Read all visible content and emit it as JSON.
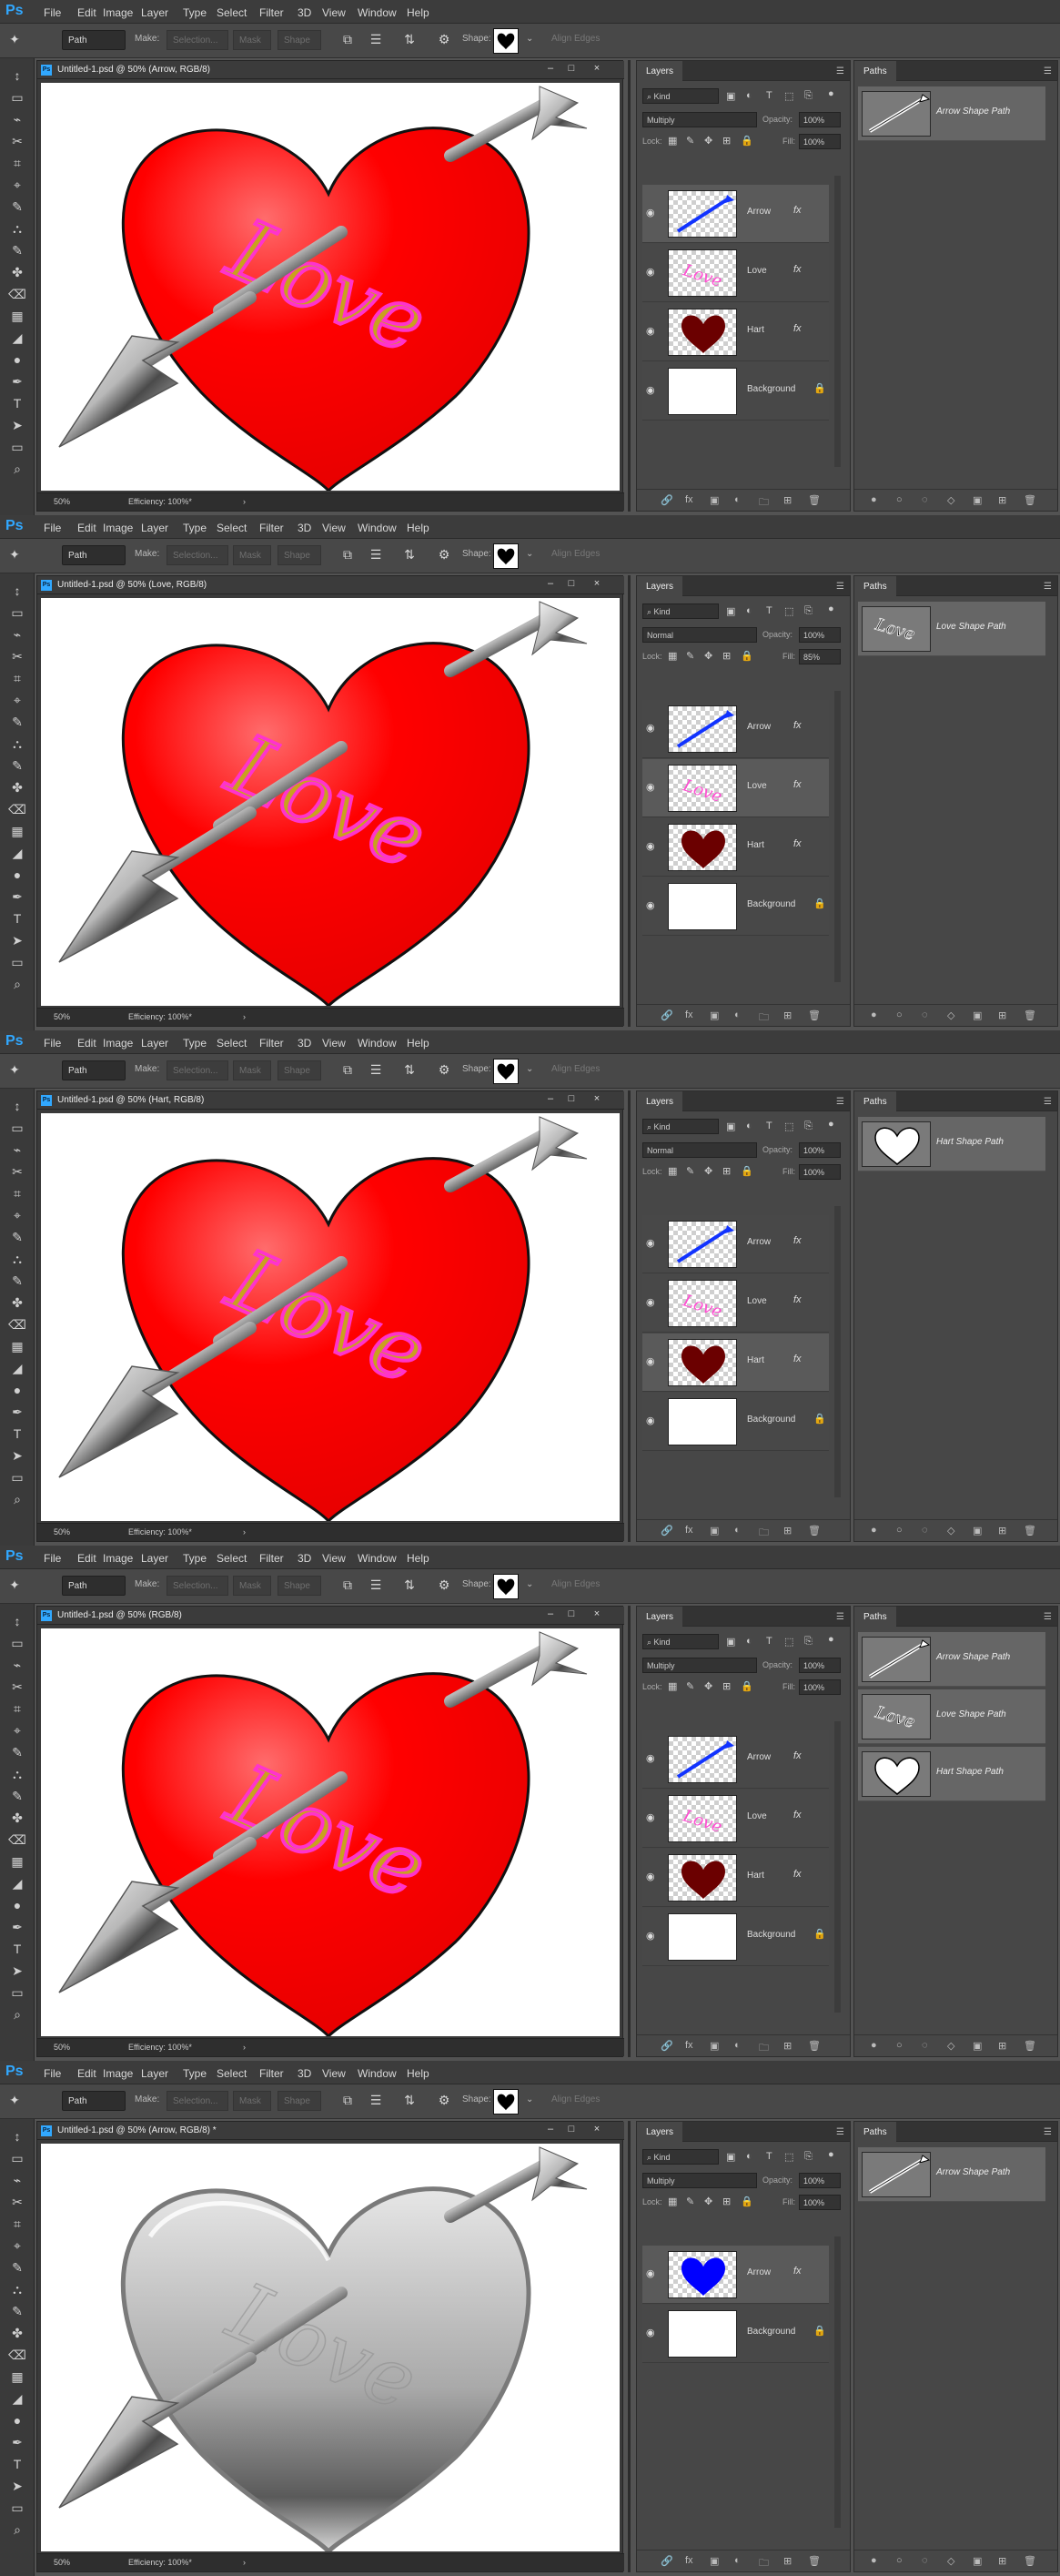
{
  "menu": [
    "File",
    "Edit",
    "Image",
    "Layer",
    "Type",
    "Select",
    "Filter",
    "3D",
    "View",
    "Window",
    "Help"
  ],
  "options": {
    "mode": "Path",
    "make_label": "Make:",
    "selection": "Selection...",
    "mask": "Mask",
    "shape": "Shape",
    "shape_label": "Shape:",
    "align_edges": "Align Edges"
  },
  "status": {
    "zoom": "50%",
    "efficiency": "Efficiency: 100%*"
  },
  "panel": {
    "layers_tab": "Layers",
    "paths_tab": "Paths",
    "kind": "Kind",
    "opacity_label": "Opacity:",
    "lock_label": "Lock:",
    "fill_label": "Fill:"
  },
  "shots": [
    {
      "doc_title": "Untitled-1.psd @ 50% (Arrow, RGB/8)",
      "blend": "Multiply",
      "opacity": "100%",
      "fill": "100%",
      "layers": [
        {
          "name": "Arrow",
          "fx": true,
          "selected": true
        },
        {
          "name": "Love",
          "fx": true
        },
        {
          "name": "Hart",
          "fx": true
        },
        {
          "name": "Background",
          "lock": true
        }
      ],
      "paths": [
        {
          "name": "Arrow Shape Path"
        }
      ]
    },
    {
      "doc_title": "Untitled-1.psd @ 50% (Love, RGB/8)",
      "blend": "Normal",
      "opacity": "100%",
      "fill": "85%",
      "layers": [
        {
          "name": "Arrow",
          "fx": true
        },
        {
          "name": "Love",
          "fx": true,
          "selected": true
        },
        {
          "name": "Hart",
          "fx": true
        },
        {
          "name": "Background",
          "lock": true
        }
      ],
      "paths": [
        {
          "name": "Love Shape Path"
        }
      ]
    },
    {
      "doc_title": "Untitled-1.psd @ 50% (Hart, RGB/8)",
      "blend": "Normal",
      "opacity": "100%",
      "fill": "100%",
      "layers": [
        {
          "name": "Arrow",
          "fx": true
        },
        {
          "name": "Love",
          "fx": true
        },
        {
          "name": "Hart",
          "fx": true,
          "selected": true
        },
        {
          "name": "Background",
          "lock": true
        }
      ],
      "paths": [
        {
          "name": "Hart Shape Path"
        }
      ]
    },
    {
      "doc_title": "Untitled-1.psd @ 50% (RGB/8)",
      "blend": "Multiply",
      "opacity": "100%",
      "fill": "100%",
      "layers": [
        {
          "name": "Arrow",
          "fx": true
        },
        {
          "name": "Love",
          "fx": true
        },
        {
          "name": "Hart",
          "fx": true
        },
        {
          "name": "Background",
          "lock": true
        }
      ],
      "paths": [
        {
          "name": "Arrow Shape Path"
        },
        {
          "name": "Love Shape Path"
        },
        {
          "name": "Hart Shape Path"
        }
      ]
    },
    {
      "doc_title": "Untitled-1.psd @ 50% (Arrow, RGB/8) *",
      "blend": "Multiply",
      "opacity": "100%",
      "fill": "100%",
      "layers": [
        {
          "name": "Arrow",
          "fx": true,
          "selected": true
        },
        {
          "name": "Background",
          "lock": true
        }
      ],
      "paths": [
        {
          "name": "Arrow Shape Path"
        }
      ]
    }
  ]
}
